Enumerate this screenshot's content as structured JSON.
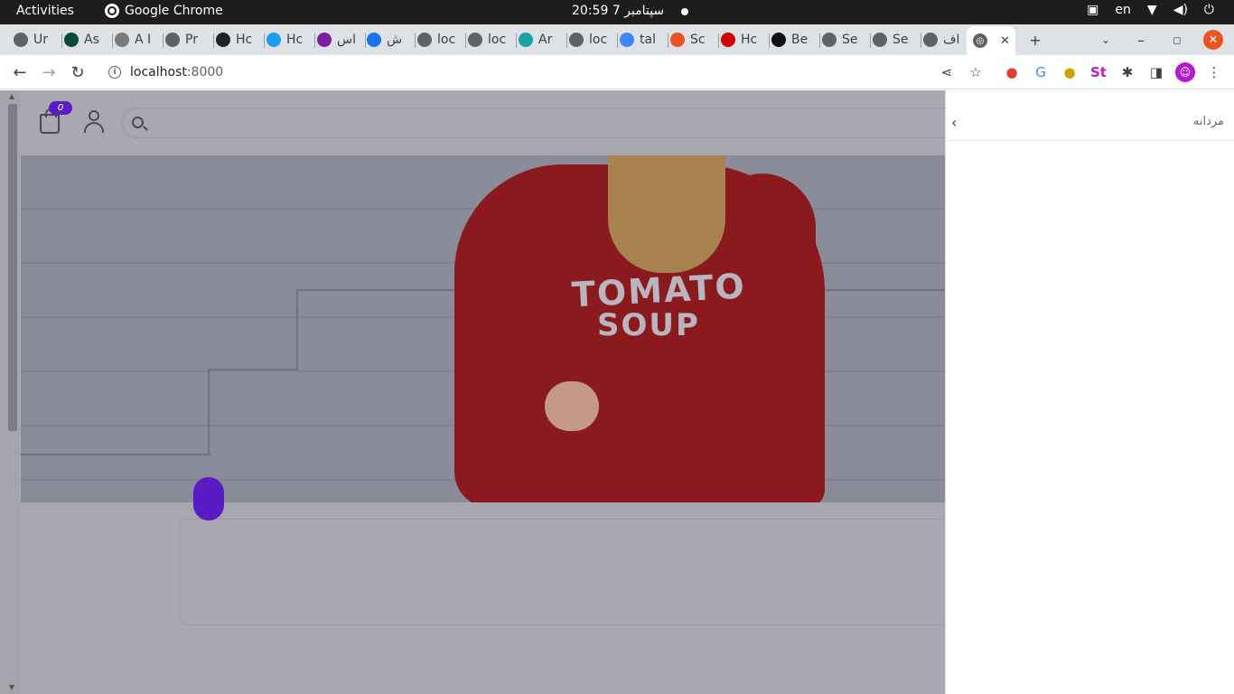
{
  "system_bar": {
    "activities": "Activities",
    "app_name": "Google Chrome",
    "clock": "20:59  سپتامبر 7",
    "language": "en"
  },
  "tabs": [
    {
      "label": "Ur",
      "icon": "globe-icon",
      "color": "#5f6368"
    },
    {
      "label": "As",
      "icon": "django-icon",
      "color": "#0c4b33"
    },
    {
      "label": "A I",
      "icon": "dataset-icon",
      "color": "#7a7a7a"
    },
    {
      "label": "Pr",
      "icon": "globe-icon",
      "color": "#5f6368"
    },
    {
      "label": "Hc",
      "icon": "openai-icon",
      "color": "#202124"
    },
    {
      "label": "Hc",
      "icon": "twitter-icon",
      "color": "#1d9bf0"
    },
    {
      "label": "اس",
      "icon": "e-icon",
      "color": "#7b1fa2"
    },
    {
      "label": "ش",
      "icon": "q-icon",
      "color": "#1a73e8"
    },
    {
      "label": "loc",
      "icon": "globe-icon",
      "color": "#5f6368"
    },
    {
      "label": "loc",
      "icon": "globe-icon",
      "color": "#5f6368"
    },
    {
      "label": "Ar",
      "icon": "cloud-icon",
      "color": "#1ba3a3"
    },
    {
      "label": "loc",
      "icon": "globe-icon",
      "color": "#5f6368"
    },
    {
      "label": "tal",
      "icon": "google-icon",
      "color": "#4285f4"
    },
    {
      "label": "Sc",
      "icon": "ubuntu-icon",
      "color": "#e95420"
    },
    {
      "label": "Hc",
      "icon": "red-logo-icon",
      "color": "#d00000"
    },
    {
      "label": "Be",
      "icon": "be-icon",
      "color": "#111111"
    },
    {
      "label": "Se",
      "icon": "globe-icon",
      "color": "#5f6368"
    },
    {
      "label": "Se",
      "icon": "globe-icon",
      "color": "#5f6368"
    },
    {
      "label": "اف",
      "icon": "globe-icon",
      "color": "#5f6368"
    }
  ],
  "active_tab": {
    "label": "",
    "icon": "globe-icon"
  },
  "toolbar": {
    "url_host": "localhost",
    "url_port": ":8000"
  },
  "site": {
    "cart_count": "0",
    "hero_print_line1": "TOMATO",
    "hero_print_line2": "SOUP"
  },
  "side_panel": {
    "title": "مردانه"
  },
  "colors": {
    "accent": "#5b1bc4",
    "overlay": "#a8a8b0",
    "ubuntu_orange": "#e95420"
  }
}
